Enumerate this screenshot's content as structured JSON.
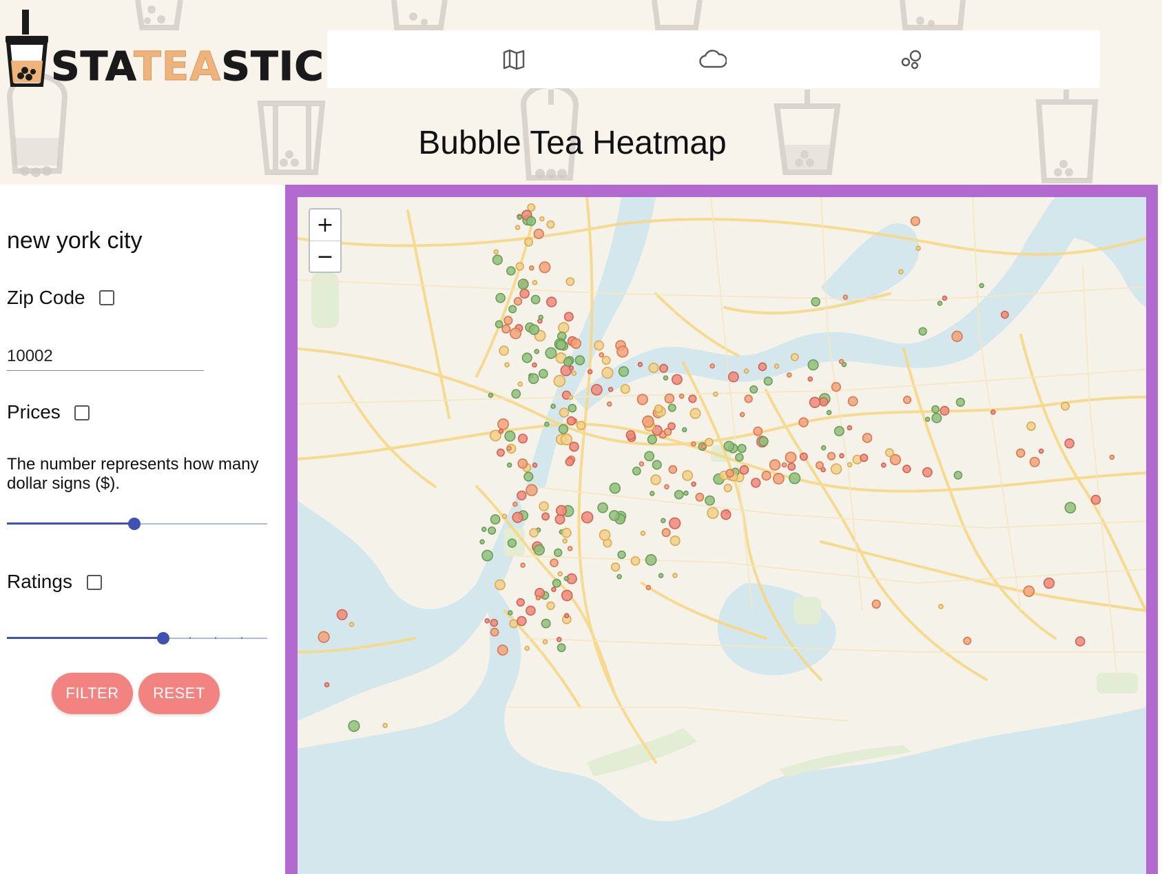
{
  "app": {
    "logo_prefix": "STA",
    "logo_highlight": "TEA",
    "logo_suffix": "STICS"
  },
  "nav": {
    "items": [
      {
        "icon": "map-icon"
      },
      {
        "icon": "cloud-icon"
      },
      {
        "icon": "bubbles-icon"
      }
    ]
  },
  "page": {
    "title": "Bubble Tea Heatmap"
  },
  "sidebar": {
    "city": "new york city",
    "zip_label": "Zip Code",
    "zip_checked": false,
    "zip_value": "10002",
    "prices_label": "Prices",
    "prices_checked": false,
    "prices_hint": "The number represents how many dollar signs ($).",
    "price_slider_fraction": 0.49,
    "ratings_label": "Ratings",
    "ratings_checked": false,
    "ratings_slider_fraction": 0.6,
    "filter_label": "FILTER",
    "reset_label": "RESET"
  },
  "map": {
    "zoom_in": "+",
    "zoom_out": "−"
  },
  "colors": {
    "header_bg": "#f8f4ec",
    "map_frame": "#b26ad0",
    "accent_button": "#f38380",
    "slider": "#3f51b5",
    "marker_green": "#8fc07a",
    "marker_yellow": "#f2d08a",
    "marker_orange": "#f2a27a",
    "marker_red": "#ee8a7a"
  }
}
